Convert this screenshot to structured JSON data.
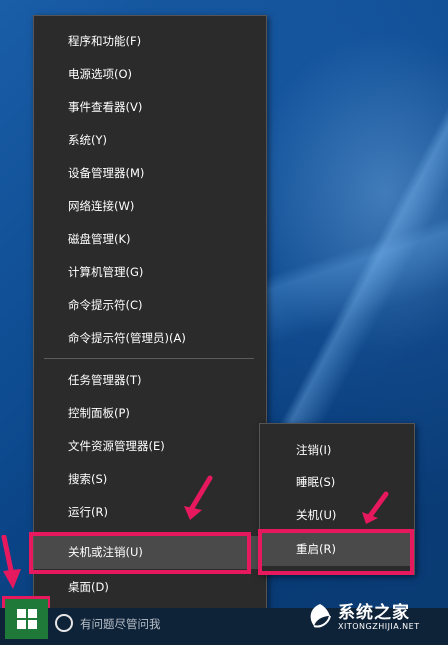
{
  "main_menu": {
    "items": [
      {
        "label": "程序和功能(F)"
      },
      {
        "label": "电源选项(O)"
      },
      {
        "label": "事件查看器(V)"
      },
      {
        "label": "系统(Y)"
      },
      {
        "label": "设备管理器(M)"
      },
      {
        "label": "网络连接(W)"
      },
      {
        "label": "磁盘管理(K)"
      },
      {
        "label": "计算机管理(G)"
      },
      {
        "label": "命令提示符(C)"
      },
      {
        "label": "命令提示符(管理员)(A)"
      },
      {
        "label": "任务管理器(T)"
      },
      {
        "label": "控制面板(P)"
      },
      {
        "label": "文件资源管理器(E)"
      },
      {
        "label": "搜索(S)"
      },
      {
        "label": "运行(R)"
      },
      {
        "label": "关机或注销(U)"
      },
      {
        "label": "桌面(D)"
      }
    ]
  },
  "sub_menu": {
    "items": [
      {
        "label": "注销(I)"
      },
      {
        "label": "睡眠(S)"
      },
      {
        "label": "关机(U)"
      },
      {
        "label": "重启(R)"
      }
    ]
  },
  "taskbar": {
    "search_placeholder": "有问题尽管问我"
  },
  "watermark": {
    "name": "系统之家",
    "site": "XITONGZHIJIA.NET"
  },
  "colors": {
    "highlight": "#e6195f",
    "menu_bg": "#2b2b2b",
    "start_bg": "#1f7a3a"
  }
}
